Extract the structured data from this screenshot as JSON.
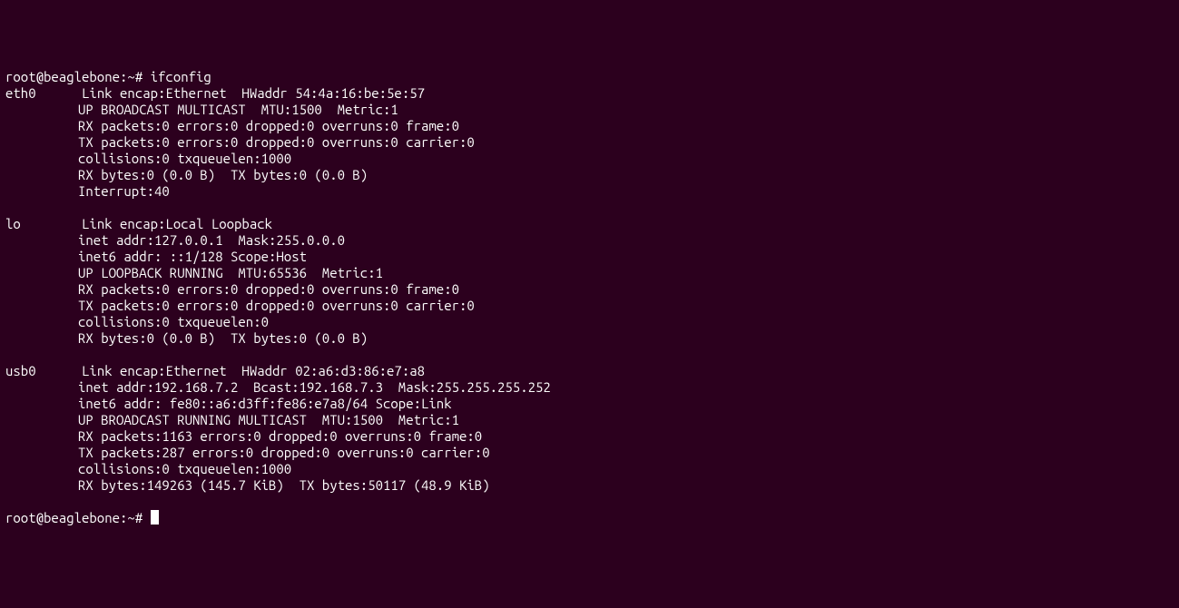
{
  "prompt1": {
    "user_host": "root@beaglebone",
    "path": ":~# ",
    "command": "ifconfig"
  },
  "interfaces": {
    "eth0": {
      "name": "eth0",
      "line1": "Link encap:Ethernet  HWaddr 54:4a:16:be:5e:57",
      "line2": "UP BROADCAST MULTICAST  MTU:1500  Metric:1",
      "line3": "RX packets:0 errors:0 dropped:0 overruns:0 frame:0",
      "line4": "TX packets:0 errors:0 dropped:0 overruns:0 carrier:0",
      "line5": "collisions:0 txqueuelen:1000",
      "line6": "RX bytes:0 (0.0 B)  TX bytes:0 (0.0 B)",
      "line7": "Interrupt:40"
    },
    "lo": {
      "name": "lo",
      "line1": "Link encap:Local Loopback",
      "line2": "inet addr:127.0.0.1  Mask:255.0.0.0",
      "line3": "inet6 addr: ::1/128 Scope:Host",
      "line4": "UP LOOPBACK RUNNING  MTU:65536  Metric:1",
      "line5": "RX packets:0 errors:0 dropped:0 overruns:0 frame:0",
      "line6": "TX packets:0 errors:0 dropped:0 overruns:0 carrier:0",
      "line7": "collisions:0 txqueuelen:0",
      "line8": "RX bytes:0 (0.0 B)  TX bytes:0 (0.0 B)"
    },
    "usb0": {
      "name": "usb0",
      "line1": "Link encap:Ethernet  HWaddr 02:a6:d3:86:e7:a8",
      "line2": "inet addr:192.168.7.2  Bcast:192.168.7.3  Mask:255.255.255.252",
      "line3": "inet6 addr: fe80::a6:d3ff:fe86:e7a8/64 Scope:Link",
      "line4": "UP BROADCAST RUNNING MULTICAST  MTU:1500  Metric:1",
      "line5": "RX packets:1163 errors:0 dropped:0 overruns:0 frame:0",
      "line6": "TX packets:287 errors:0 dropped:0 overruns:0 carrier:0",
      "line7": "collisions:0 txqueuelen:1000",
      "line8": "RX bytes:149263 (145.7 KiB)  TX bytes:50117 (48.9 KiB)"
    }
  },
  "prompt2": {
    "user_host": "root@beaglebone",
    "path": ":~# "
  }
}
